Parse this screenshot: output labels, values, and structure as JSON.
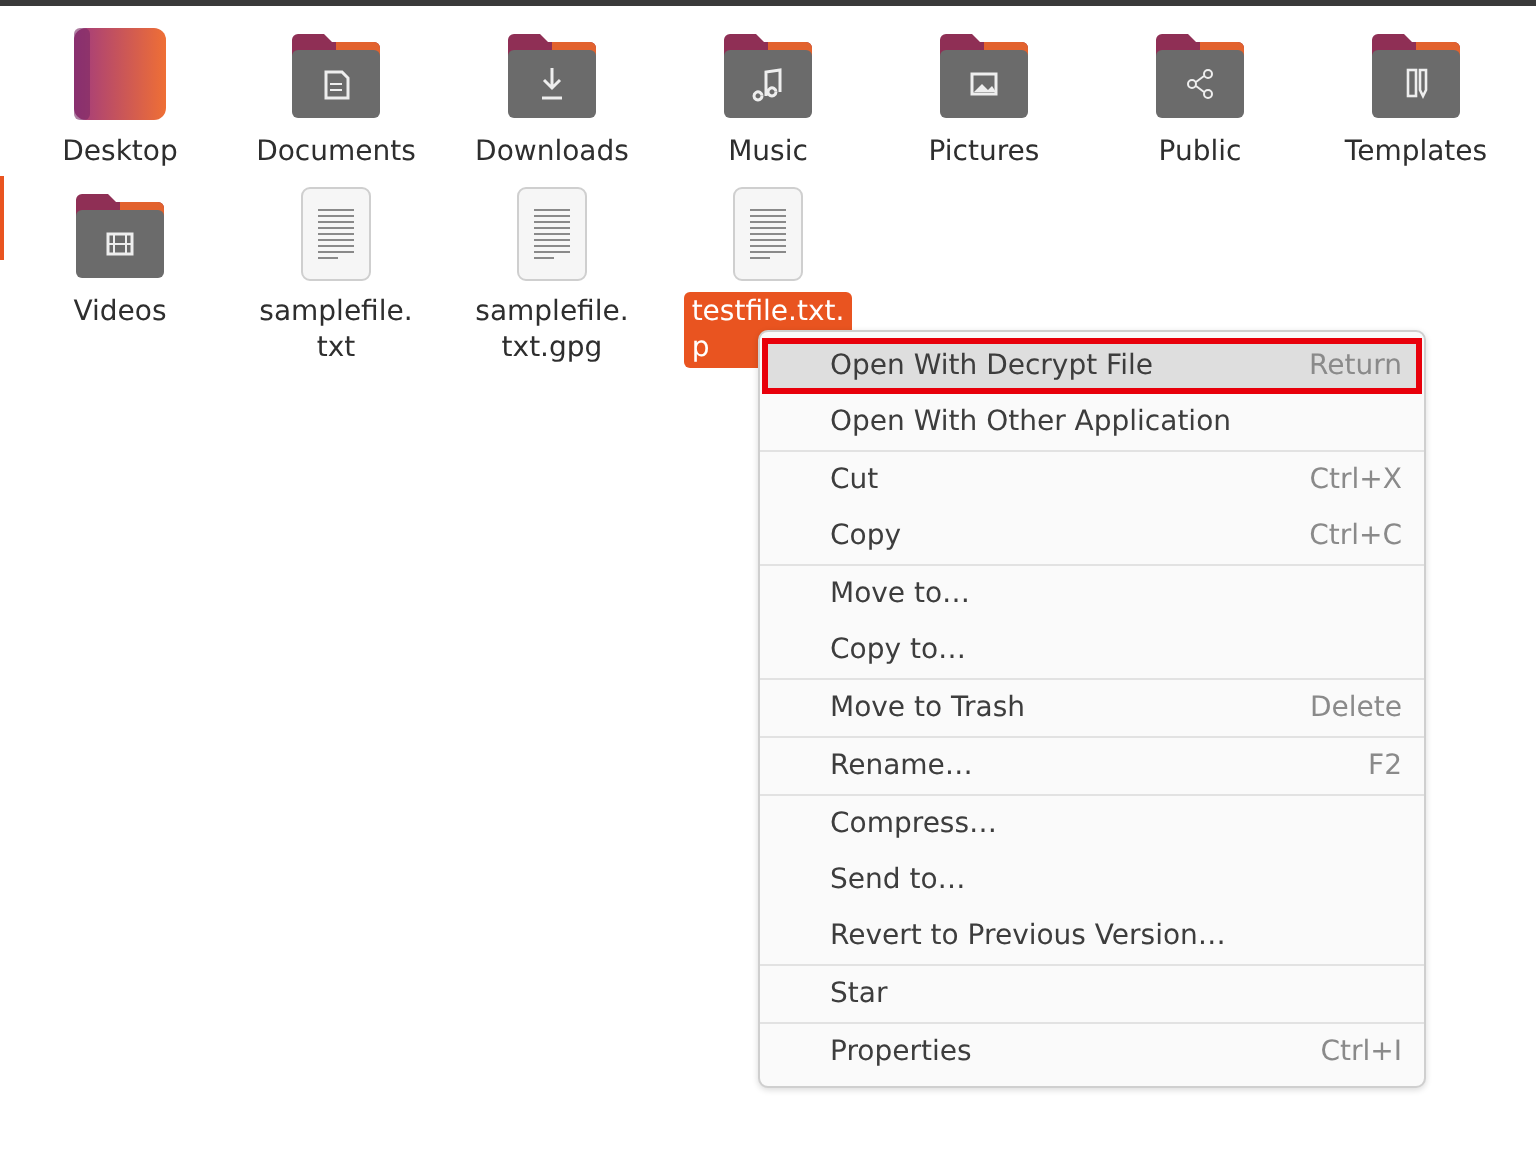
{
  "files": [
    {
      "kind": "desktop",
      "name_lines": [
        "Desktop"
      ],
      "selected": false
    },
    {
      "kind": "folder",
      "name_lines": [
        "Documents"
      ],
      "selected": false
    },
    {
      "kind": "folder",
      "name_lines": [
        "Downloads"
      ],
      "selected": false
    },
    {
      "kind": "folder",
      "name_lines": [
        "Music"
      ],
      "selected": false
    },
    {
      "kind": "folder",
      "name_lines": [
        "Pictures"
      ],
      "selected": false
    },
    {
      "kind": "folder",
      "name_lines": [
        "Public"
      ],
      "selected": false
    },
    {
      "kind": "folder",
      "name_lines": [
        "Templates"
      ],
      "selected": false
    },
    {
      "kind": "folder",
      "name_lines": [
        "Videos"
      ],
      "selected": false
    },
    {
      "kind": "file",
      "name_lines": [
        "samplefile.",
        "txt"
      ],
      "selected": false
    },
    {
      "kind": "file",
      "name_lines": [
        "samplefile.",
        "txt.gpg"
      ],
      "selected": false
    },
    {
      "kind": "file",
      "name_lines": [
        "testfile.txt.",
        "p"
      ],
      "selected": true
    }
  ],
  "context_menu": {
    "groups": [
      [
        {
          "label": "Open With Decrypt File",
          "shortcut": "Return",
          "highlighted": true
        },
        {
          "label": "Open With Other Application",
          "highlighted": false
        }
      ],
      [
        {
          "label": "Cut",
          "shortcut": "Ctrl+X",
          "highlighted": false
        },
        {
          "label": "Copy",
          "shortcut": "Ctrl+C",
          "highlighted": false
        }
      ],
      [
        {
          "label": "Move to…",
          "highlighted": false
        },
        {
          "label": "Copy to…",
          "highlighted": false
        }
      ],
      [
        {
          "label": "Move to Trash",
          "shortcut": "Delete",
          "highlighted": false
        }
      ],
      [
        {
          "label": "Rename…",
          "shortcut": "F2",
          "highlighted": false
        }
      ],
      [
        {
          "label": "Compress…",
          "highlighted": false
        },
        {
          "label": "Send to…",
          "highlighted": false
        },
        {
          "label": "Revert to Previous Version…",
          "highlighted": false
        }
      ],
      [
        {
          "label": "Star",
          "highlighted": false
        }
      ],
      [
        {
          "label": "Properties",
          "shortcut": "Ctrl+I",
          "highlighted": false
        }
      ]
    ]
  }
}
